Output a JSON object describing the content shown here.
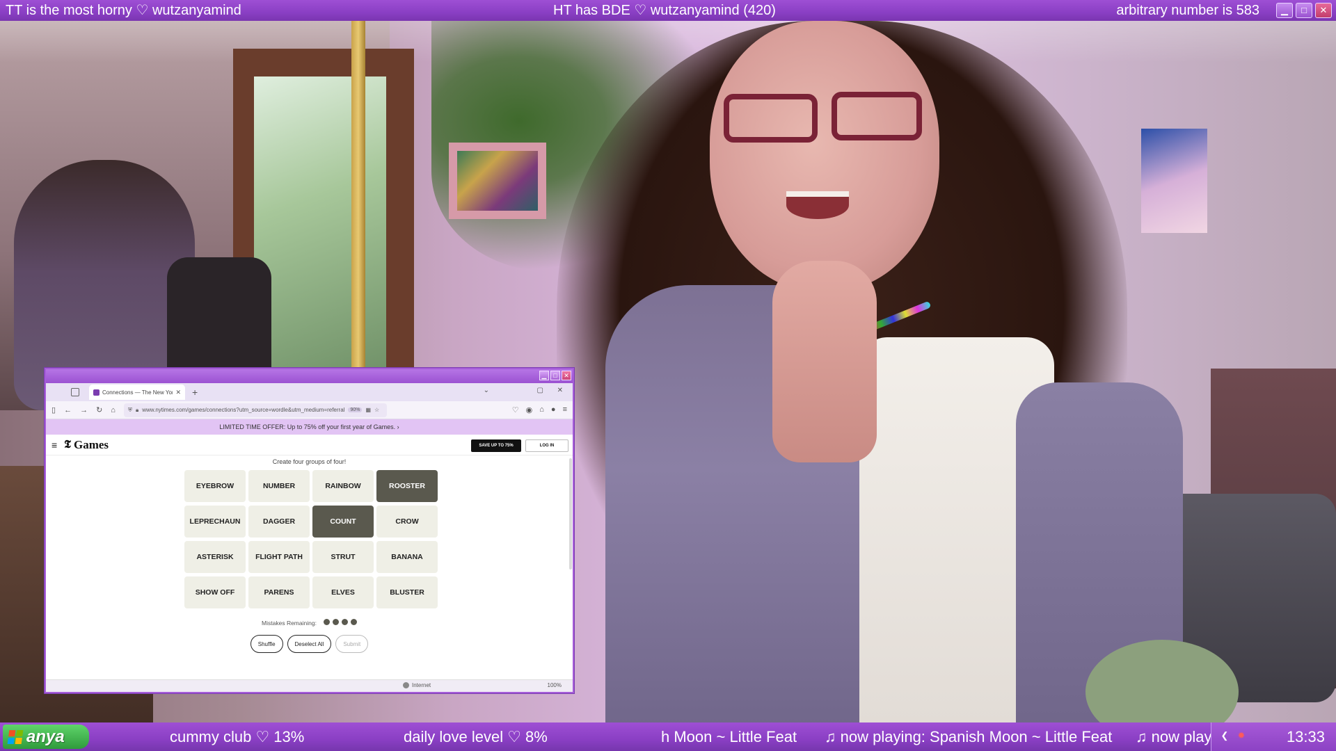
{
  "stream": {
    "top_left": "TT is the most horny ♡ wutzanyamind",
    "top_center": "HT has BDE ♡ wutzanyamind (420)",
    "top_right": "arbitrary number is 583",
    "start_label": "anya",
    "bottom_items": [
      "cummy club ♡ 13%",
      "daily love level ♡ 8%",
      "h Moon ~ Little Feat",
      "♫ now playing: Spanish Moon ~ Little Feat",
      "♫ now playing:"
    ],
    "clock": "13:33"
  },
  "browser": {
    "tab_title": "Connections — The New York Times",
    "url": "www.nytimes.com/games/connections?utm_source=wordle&utm_medium=referral",
    "zoom_badge": "90%",
    "promo_text": "LIMITED TIME OFFER: Up to 75% off your first year of Games.",
    "promo_arrow": "›",
    "status_internet": "Internet",
    "status_zoom": "100%"
  },
  "nyt": {
    "logo": "𝕿",
    "section": "Games",
    "subscribe_label": "SAVE UP TO 75%",
    "login_label": "LOG IN"
  },
  "connections": {
    "instruction": "Create four groups of four!",
    "tiles": [
      {
        "word": "EYEBROW",
        "selected": false
      },
      {
        "word": "NUMBER",
        "selected": false
      },
      {
        "word": "RAINBOW",
        "selected": false
      },
      {
        "word": "ROOSTER",
        "selected": true
      },
      {
        "word": "LEPRECHAUN",
        "selected": false
      },
      {
        "word": "DAGGER",
        "selected": false
      },
      {
        "word": "COUNT",
        "selected": true
      },
      {
        "word": "CROW",
        "selected": false
      },
      {
        "word": "ASTERISK",
        "selected": false
      },
      {
        "word": "FLIGHT PATH",
        "selected": false
      },
      {
        "word": "STRUT",
        "selected": false
      },
      {
        "word": "BANANA",
        "selected": false
      },
      {
        "word": "SHOW OFF",
        "selected": false
      },
      {
        "word": "PARENS",
        "selected": false
      },
      {
        "word": "ELVES",
        "selected": false
      },
      {
        "word": "BLUSTER",
        "selected": false
      }
    ],
    "mistakes_label": "Mistakes Remaining:",
    "mistakes_remaining": 4,
    "shuffle_label": "Shuffle",
    "deselect_label": "Deselect All",
    "submit_label": "Submit"
  },
  "colors": {
    "theme_purple": "#8a3fc4",
    "tile_bg": "#efefe6",
    "tile_selected": "#5a594e",
    "promo_bg": "#e2c4f4"
  }
}
